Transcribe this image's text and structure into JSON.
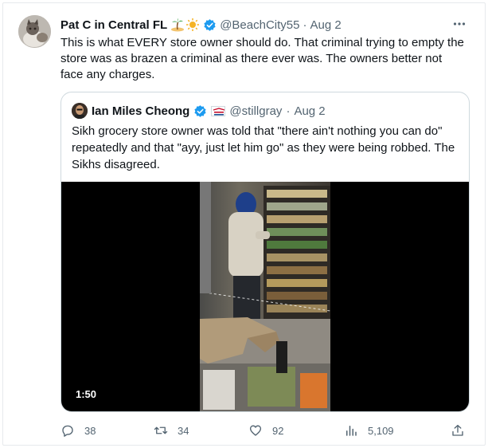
{
  "tweet": {
    "author_name": "Pat C in Central FL",
    "author_emojis": [
      "island-icon",
      "sun-icon"
    ],
    "handle": "@BeachCity55",
    "separator": "·",
    "date": "Aug 2",
    "more_label": "···",
    "text": "This is what EVERY store owner should do. That criminal trying to empty the store was as brazen a criminal as there ever was. The owners better not face  any charges."
  },
  "quote": {
    "author_name": "Ian Miles Cheong",
    "handle": "@stillgray",
    "separator": "·",
    "date": "Aug 2",
    "text": "Sikh grocery store owner was told that \"there ain't nothing you can do\" repeatedly and that \"ayy, just let him go\" as they were being robbed. The Sikhs disagreed.",
    "video_duration": "1:50"
  },
  "actions": {
    "replies": "38",
    "retweets": "34",
    "likes": "92",
    "views": "5,109"
  },
  "colors": {
    "verified_blue": "#1d9bf0",
    "muted": "#536471",
    "border": "#cfd9de"
  }
}
